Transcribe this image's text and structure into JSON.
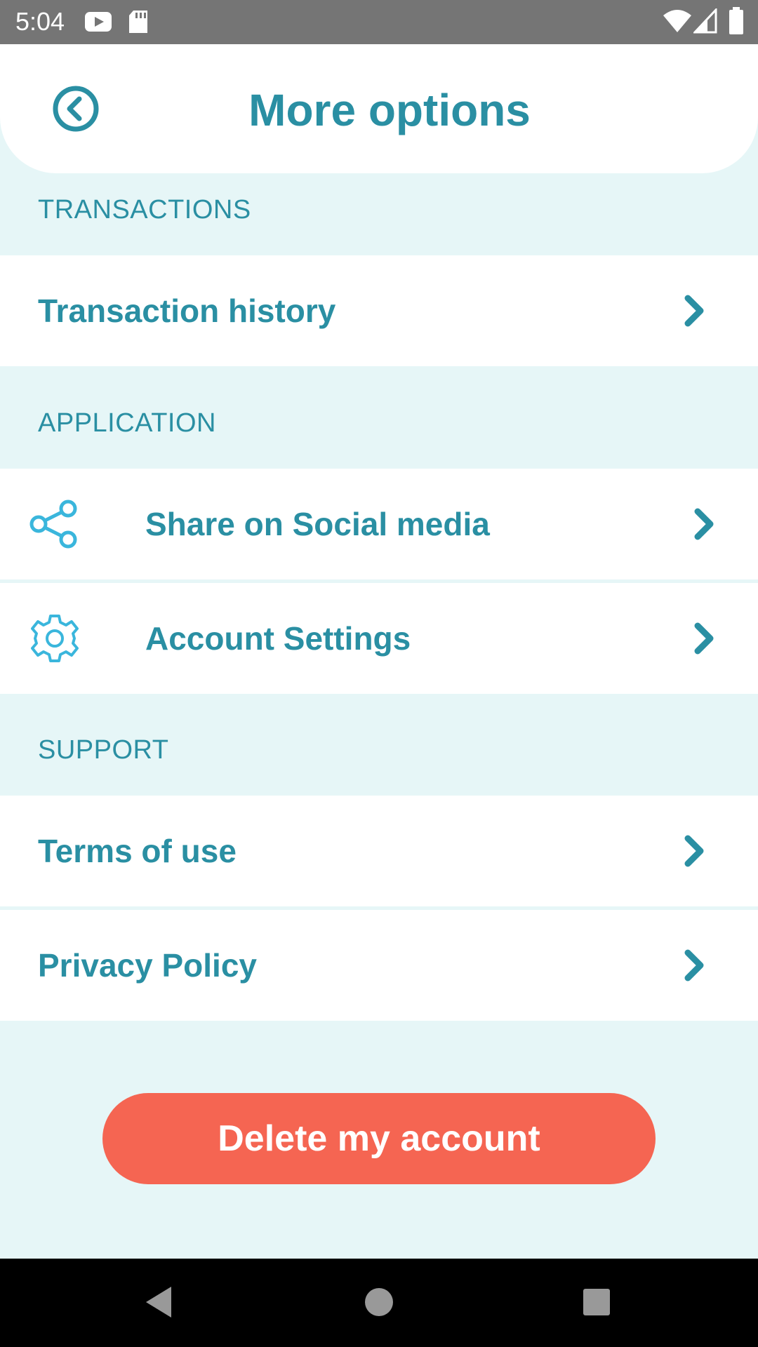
{
  "status_bar": {
    "time": "5:04",
    "icons": [
      "youtube-icon",
      "sd-card-icon",
      "wifi-icon",
      "cell-signal-icon",
      "battery-icon"
    ]
  },
  "header": {
    "title": "More options",
    "back_icon": "back-circle-icon"
  },
  "sections": {
    "transactions": {
      "label": "TRANSACTIONS",
      "items": [
        {
          "label": "Transaction history"
        }
      ]
    },
    "application": {
      "label": "APPLICATION",
      "items": [
        {
          "label": "Share on Social media",
          "icon": "share-icon"
        },
        {
          "label": "Account Settings",
          "icon": "gear-icon"
        }
      ]
    },
    "support": {
      "label": "SUPPORT",
      "items": [
        {
          "label": "Terms of use"
        },
        {
          "label": "Privacy Policy"
        }
      ]
    }
  },
  "delete_button": {
    "label": "Delete my account"
  },
  "nav_bar": {
    "buttons": [
      "back-triangle-icon",
      "home-circle-icon",
      "recents-square-icon"
    ]
  },
  "colors": {
    "accent": "#2a8fa3",
    "icon_light": "#3ab6dc",
    "background": "#e6f6f7",
    "danger": "#f56552"
  }
}
